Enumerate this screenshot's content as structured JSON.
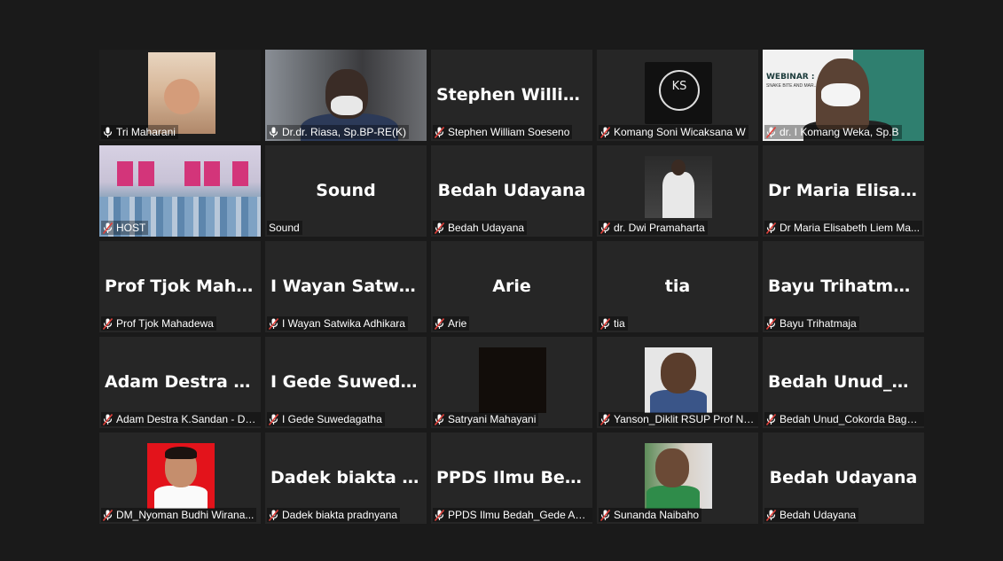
{
  "participants": [
    {
      "display": "",
      "label": "Tri Maharani",
      "mic": "unmuted",
      "video": "tri",
      "active": true
    },
    {
      "display": "",
      "label": "Dr.dr. Riasa, Sp.BP-RE(K)",
      "mic": "unmuted",
      "video": "riasa",
      "active": false
    },
    {
      "display": "Stephen Willia...",
      "label": "Stephen William Soeseno",
      "mic": "muted",
      "video": "",
      "active": false
    },
    {
      "display": "",
      "label": "Komang Soni Wicaksana W",
      "mic": "muted",
      "video": "ks",
      "active": false
    },
    {
      "display": "",
      "label": "dr. I Komang Weka, Sp.B",
      "mic": "muted",
      "video": "weka",
      "active": false
    },
    {
      "display": "",
      "label": "HOST",
      "mic": "muted",
      "video": "host",
      "active": false
    },
    {
      "display": "Sound",
      "label": "Sound",
      "mic": "none",
      "video": "",
      "active": false
    },
    {
      "display": "Bedah Udayana",
      "label": "Bedah Udayana",
      "mic": "muted",
      "video": "",
      "active": false
    },
    {
      "display": "",
      "label": "dr. Dwi Pramaharta",
      "mic": "muted",
      "video": "dwi",
      "active": false
    },
    {
      "display": "Dr Maria Elisab...",
      "label": "Dr Maria Elisabeth Liem Ma...",
      "mic": "muted",
      "video": "",
      "active": false
    },
    {
      "display": "Prof Tjok Maha...",
      "label": "Prof Tjok Mahadewa",
      "mic": "muted",
      "video": "",
      "active": false
    },
    {
      "display": "I Wayan Satwik...",
      "label": "I Wayan Satwika Adhikara",
      "mic": "muted",
      "video": "",
      "active": false
    },
    {
      "display": "Arie",
      "label": "Arie",
      "mic": "muted",
      "video": "",
      "active": false
    },
    {
      "display": "tia",
      "label": "tia",
      "mic": "muted",
      "video": "",
      "active": false
    },
    {
      "display": "Bayu Trihatmaja",
      "label": "Bayu Trihatmaja",
      "mic": "muted",
      "video": "",
      "active": false
    },
    {
      "display": "Adam Destra K....",
      "label": "Adam Destra K.Sandan - DAM",
      "mic": "muted",
      "video": "",
      "active": false
    },
    {
      "display": "I Gede Suweda...",
      "label": "I Gede Suwedagatha",
      "mic": "muted",
      "video": "",
      "active": false
    },
    {
      "display": "",
      "label": "Satryani Mahayani",
      "mic": "muted",
      "video": "sat",
      "active": false
    },
    {
      "display": "",
      "label": "Yanson_Diklit RSUP Prof Ng...",
      "mic": "muted",
      "video": "yan",
      "active": false
    },
    {
      "display": "Bedah Unud_Co...",
      "label": "Bedah Unud_Cokorda Bagus...",
      "mic": "muted",
      "video": "",
      "active": false
    },
    {
      "display": "",
      "label": "DM_Nyoman Budhi Wirana...",
      "mic": "muted",
      "video": "dm",
      "active": false
    },
    {
      "display": "Dadek biakta pr...",
      "label": "Dadek biakta pradnyana",
      "mic": "muted",
      "video": "",
      "active": false
    },
    {
      "display": "PPDS Ilmu Bed...",
      "label": "PPDS Ilmu Bedah_Gede Adi ...",
      "mic": "muted",
      "video": "",
      "active": false
    },
    {
      "display": "",
      "label": "Sunanda Naibaho",
      "mic": "muted",
      "video": "sun",
      "active": false
    },
    {
      "display": "Bedah Udayana",
      "label": "Bedah Udayana",
      "mic": "muted",
      "video": "",
      "active": false
    }
  ],
  "weka_slide": {
    "title": "WEBINAR :",
    "subtitle": "SNAKE BITE AND MAR... VENOMOUS BITE"
  },
  "ks_logo": "KS",
  "colors": {
    "active_border": "#c9e04a",
    "muted_icon": "#e0403a",
    "tile_bg": "#262626",
    "page_bg": "#1a1a1a"
  }
}
